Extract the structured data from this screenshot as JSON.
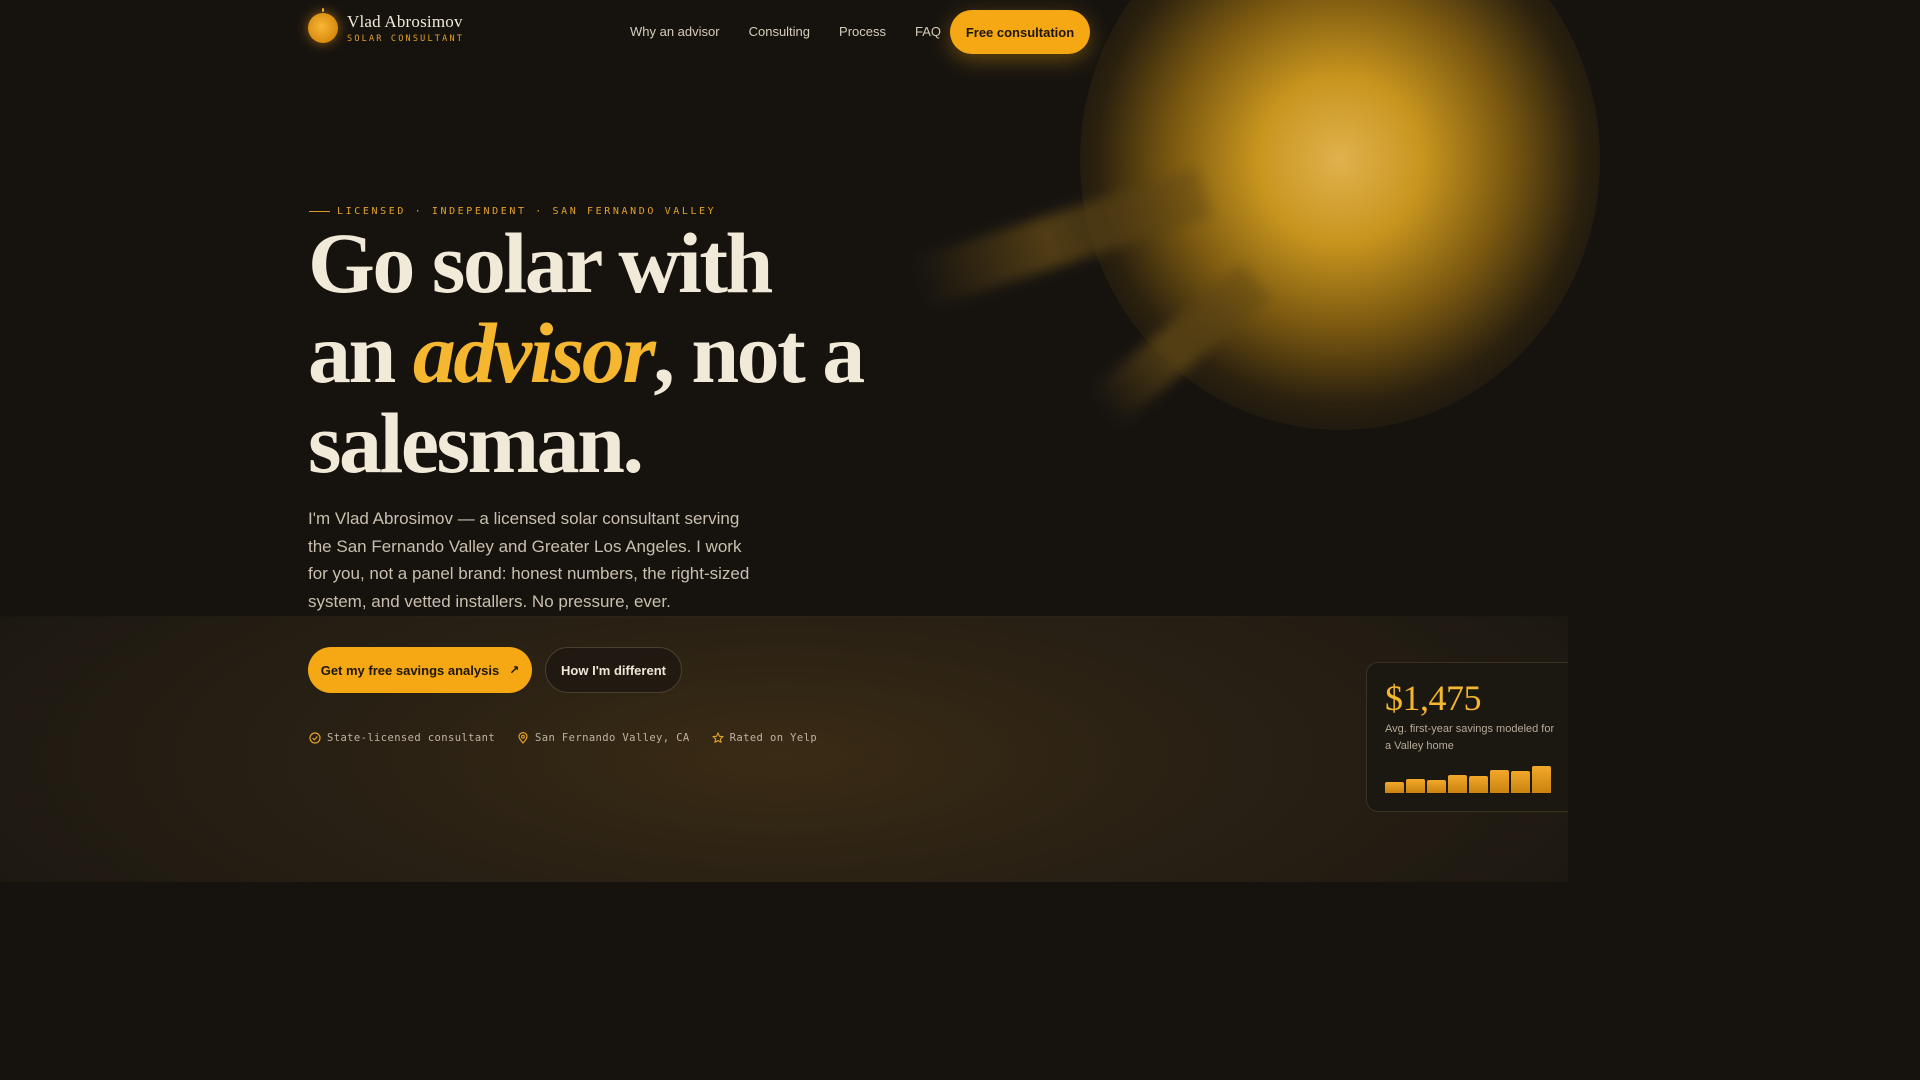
{
  "brand": {
    "name": "Vlad Abrosimov",
    "tagline": "SOLAR CONSULTANT",
    "logo_icon": "sun-icon"
  },
  "nav": {
    "items": [
      {
        "label": "Why an advisor"
      },
      {
        "label": "Consulting"
      },
      {
        "label": "Process"
      },
      {
        "label": "FAQ"
      }
    ],
    "cta_label": "Free consultation"
  },
  "hero": {
    "eyebrow": "LICENSED · INDEPENDENT · SAN FERNANDO VALLEY",
    "headline_part1": "Go solar with an",
    "headline_accent": "advisor",
    "headline_part2": ", not a salesman.",
    "lead": "I'm Vlad Abrosimov — a licensed solar consultant serving the San Fernando Valley and Greater Los Angeles. I work for you, not a panel brand: honest numbers, the right-sized system, and vetted installers. No pressure, ever.",
    "primary_cta": "Get my free savings analysis",
    "primary_cta_icon": "arrow-up-right-icon",
    "secondary_cta": "How I'm different"
  },
  "badges": [
    {
      "icon": "check-circle-icon",
      "label": "State-licensed consultant"
    },
    {
      "icon": "map-pin-icon",
      "label": "San Fernando Valley, CA"
    },
    {
      "icon": "star-icon",
      "label": "Rated on Yelp"
    }
  ],
  "savings_card": {
    "amount": "$1,475",
    "description": "Avg. first-year savings modeled for a Valley home",
    "bar_levels": [
      0.35,
      0.48,
      0.42,
      0.6,
      0.55,
      0.75,
      0.72,
      0.9
    ]
  },
  "colors": {
    "background": "#16130f",
    "accent": "#f5a813",
    "accent_text": "#f5b630",
    "text": "#efe6d6"
  }
}
